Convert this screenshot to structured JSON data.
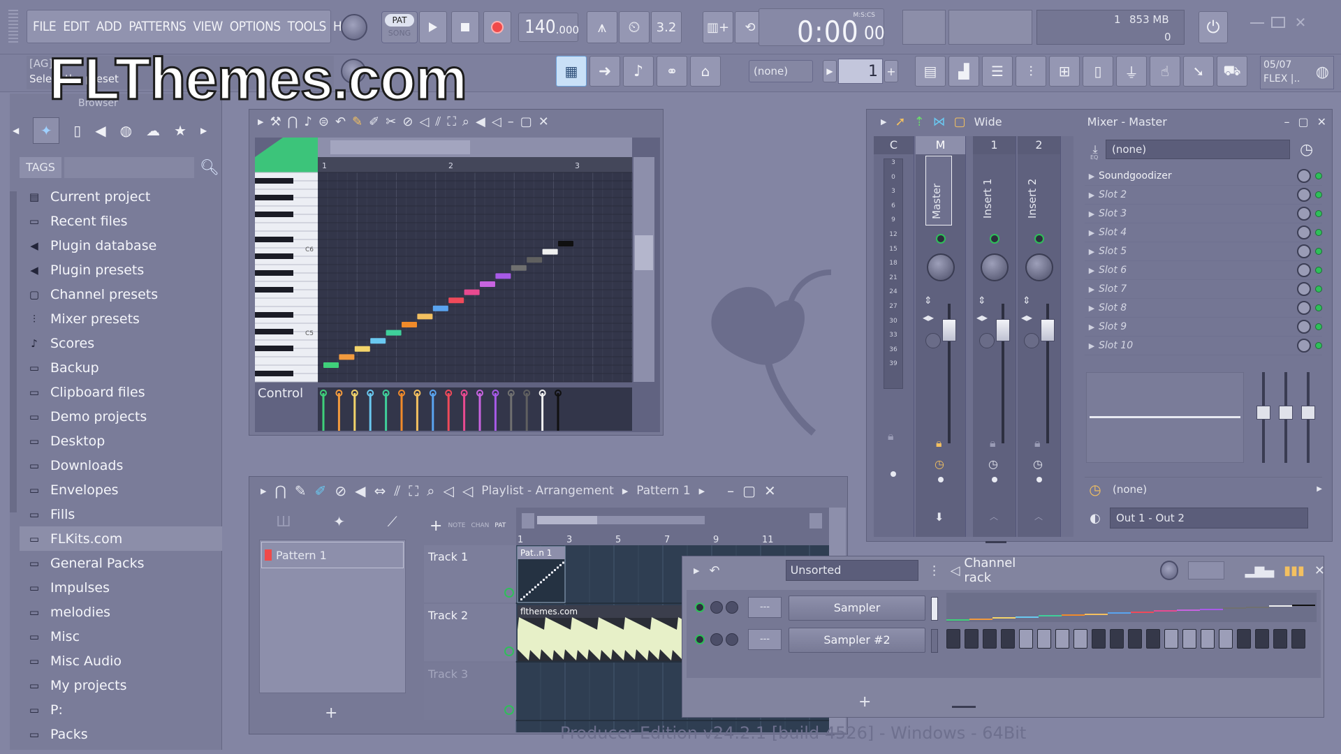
{
  "watermark": "FLThemes.com",
  "menu": [
    "FILE",
    "EDIT",
    "ADD",
    "PATTERNS",
    "VIEW",
    "OPTIONS",
    "TOOLS",
    "HELP"
  ],
  "transport": {
    "pat_label": "PAT",
    "song_label": "SONG",
    "tempo": "140",
    "tempo_decimal": ".000",
    "time": "0:00",
    "time_small": "00",
    "time_unit": "M:S:CS",
    "meter_a": "1",
    "memory": "853 MB",
    "meter_b": "0"
  },
  "hint": {
    "top": "[AG]",
    "bottom": "Select the preset"
  },
  "toolbar2": {
    "pattern_select": "(none)",
    "pattern_num": "1",
    "news_date": "05/07",
    "news_title": "FLEX |.."
  },
  "browser": {
    "title": "Browser",
    "tags_label": "TAGS",
    "items": [
      {
        "label": "Current project",
        "icon": "doc"
      },
      {
        "label": "Recent files",
        "icon": "folder"
      },
      {
        "label": "Plugin database",
        "icon": "plug"
      },
      {
        "label": "Plugin presets",
        "icon": "plug"
      },
      {
        "label": "Channel presets",
        "icon": "chan"
      },
      {
        "label": "Mixer presets",
        "icon": "mixer"
      },
      {
        "label": "Scores",
        "icon": "note"
      },
      {
        "label": "Backup",
        "icon": "folder"
      },
      {
        "label": "Clipboard files",
        "icon": "folder"
      },
      {
        "label": "Demo projects",
        "icon": "folder"
      },
      {
        "label": "Desktop",
        "icon": "folder"
      },
      {
        "label": "Downloads",
        "icon": "folder"
      },
      {
        "label": "Envelopes",
        "icon": "folder"
      },
      {
        "label": "Fills",
        "icon": "folder"
      },
      {
        "label": "FLKits.com",
        "icon": "folder",
        "selected": true
      },
      {
        "label": "General Packs",
        "icon": "folder"
      },
      {
        "label": "Impulses",
        "icon": "folder"
      },
      {
        "label": "melodies",
        "icon": "folder"
      },
      {
        "label": "Misc",
        "icon": "folder"
      },
      {
        "label": "Misc Audio",
        "icon": "folder"
      },
      {
        "label": "My projects",
        "icon": "folder"
      },
      {
        "label": "P:",
        "icon": "folder"
      },
      {
        "label": "Packs",
        "icon": "folder"
      }
    ]
  },
  "piano_roll": {
    "bar_labels": [
      "1",
      "2",
      "3"
    ],
    "key_labels": [
      "C6",
      "C5"
    ],
    "control_label": "Control",
    "notes": [
      {
        "step": 0,
        "pitch": 0,
        "color": "#3fd07a"
      },
      {
        "step": 1,
        "pitch": 1,
        "color": "#f29a3e"
      },
      {
        "step": 2,
        "pitch": 2,
        "color": "#f3d46a"
      },
      {
        "step": 3,
        "pitch": 3,
        "color": "#6ac8f0"
      },
      {
        "step": 4,
        "pitch": 4,
        "color": "#3fcf9a"
      },
      {
        "step": 5,
        "pitch": 5,
        "color": "#f08a2a"
      },
      {
        "step": 6,
        "pitch": 6,
        "color": "#f3c060"
      },
      {
        "step": 7,
        "pitch": 7,
        "color": "#5aa4f0"
      },
      {
        "step": 8,
        "pitch": 8,
        "color": "#f04a5a"
      },
      {
        "step": 9,
        "pitch": 9,
        "color": "#e84a90"
      },
      {
        "step": 10,
        "pitch": 10,
        "color": "#c864e0"
      },
      {
        "step": 11,
        "pitch": 11,
        "color": "#a85ae8"
      },
      {
        "step": 12,
        "pitch": 12,
        "color": "#707070"
      },
      {
        "step": 13,
        "pitch": 13,
        "color": "#606060"
      },
      {
        "step": 14,
        "pitch": 14,
        "color": "#f0f0f0"
      },
      {
        "step": 15,
        "pitch": 15,
        "color": "#101010"
      }
    ]
  },
  "mixer": {
    "title": "Mixer - Master",
    "preset": "Wide",
    "tracks": [
      {
        "header": "C",
        "name": ""
      },
      {
        "header": "M",
        "name": "Master"
      },
      {
        "header": "1",
        "name": "Insert 1"
      },
      {
        "header": "2",
        "name": "Insert 2"
      }
    ],
    "meter_scale": [
      "3",
      "0",
      "3",
      "6",
      "9",
      "12",
      "15",
      "18",
      "21",
      "24",
      "27",
      "30",
      "33",
      "36",
      "39"
    ],
    "fx_select": "(none)",
    "eq_label": "EQ",
    "slots": [
      "Soundgoodizer",
      "Slot 2",
      "Slot 3",
      "Slot 4",
      "Slot 5",
      "Slot 6",
      "Slot 7",
      "Slot 8",
      "Slot 9",
      "Slot 10"
    ],
    "sidechain": "(none)",
    "output": "Out 1 - Out 2"
  },
  "playlist": {
    "title": "Playlist - Arrangement",
    "pattern_crumb": "Pattern 1",
    "pattern_item": "Pattern 1",
    "tool_labels": [
      "NOTE",
      "CHAN",
      "PAT"
    ],
    "ruler": [
      "1",
      "3",
      "5",
      "7",
      "9",
      "11"
    ],
    "tracks": [
      "Track 1",
      "Track 2",
      "Track 3"
    ],
    "clip1": "Pat..n 1",
    "clip2": "flthemes.com"
  },
  "channel_rack": {
    "title": "Channel rack",
    "filter": "Unsorted",
    "channels": [
      {
        "name": "Sampler",
        "route": "---"
      },
      {
        "name": "Sampler #2",
        "route": "---"
      }
    ]
  },
  "status": "Producer Edition v24.2.1 [build 4526] - Windows - 64Bit"
}
